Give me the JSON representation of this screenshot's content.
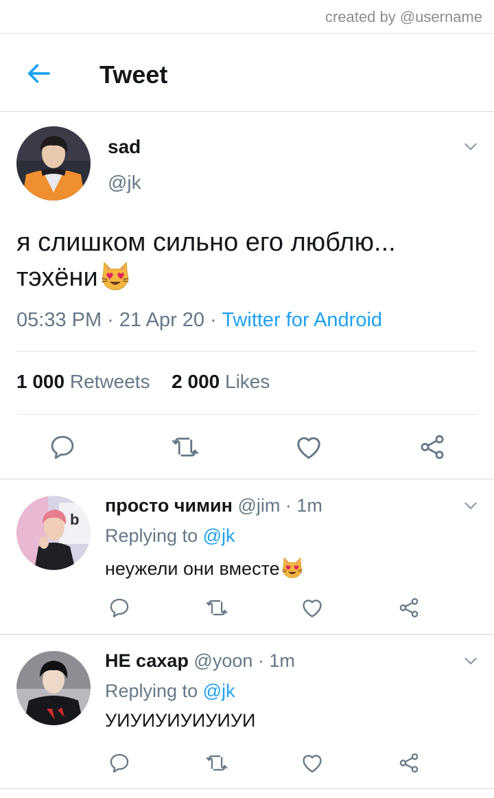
{
  "credit": "created by @username",
  "header": {
    "title": "Tweet"
  },
  "tweet": {
    "name": "sad",
    "handle": "@jk",
    "text_line1": "я слишком сильно его люблю...",
    "text_line2": "тэхёни",
    "emoji": "smiling-cat-heart-eyes",
    "time": "05:33 PM · 21 Apr 20 · ",
    "source": "Twitter for Android",
    "retweets_count": "1 000",
    "retweets_label": "Retweets",
    "likes_count": "2 000",
    "likes_label": "Likes"
  },
  "replies": [
    {
      "name": "просто чимин",
      "handle": "@jim",
      "time": " · 1m",
      "replying_prefix": "Replying to ",
      "replying_handle": "@jk",
      "text": "неужели они вместе",
      "emoji": "smiling-cat-heart-eyes"
    },
    {
      "name": "НЕ сахар",
      "handle": "@yoon",
      "time": " · 1m",
      "replying_prefix": "Replying to ",
      "replying_handle": "@jk",
      "text": "УИУИУИУИУИУИ"
    }
  ],
  "colors": {
    "accent": "#1da1f2",
    "muted": "#657786",
    "text": "#14171a",
    "divider": "#e1e4e6"
  }
}
